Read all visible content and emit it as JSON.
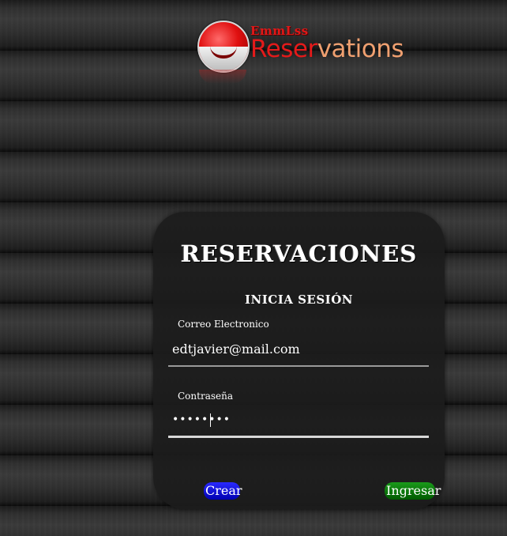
{
  "logo": {
    "small_text": "EmmLss",
    "big_text_part1": "Reser",
    "big_text_part2": "vations"
  },
  "login": {
    "title": "RESERVACIONES",
    "subtitle": "INICIA SESIÓN",
    "email": {
      "label": "Correo Electronico",
      "value": "edtjavier@mail.com"
    },
    "password": {
      "label": "Contraseña",
      "value": "••••••••"
    },
    "buttons": {
      "create_label": "Crear",
      "login_label": "Ingresar"
    }
  },
  "colors": {
    "create_button": "#0000c8",
    "login_button": "#007a00",
    "card_background": "#1c1c1c",
    "logo_red": "#e41a1a",
    "logo_orange": "#f0a070"
  }
}
